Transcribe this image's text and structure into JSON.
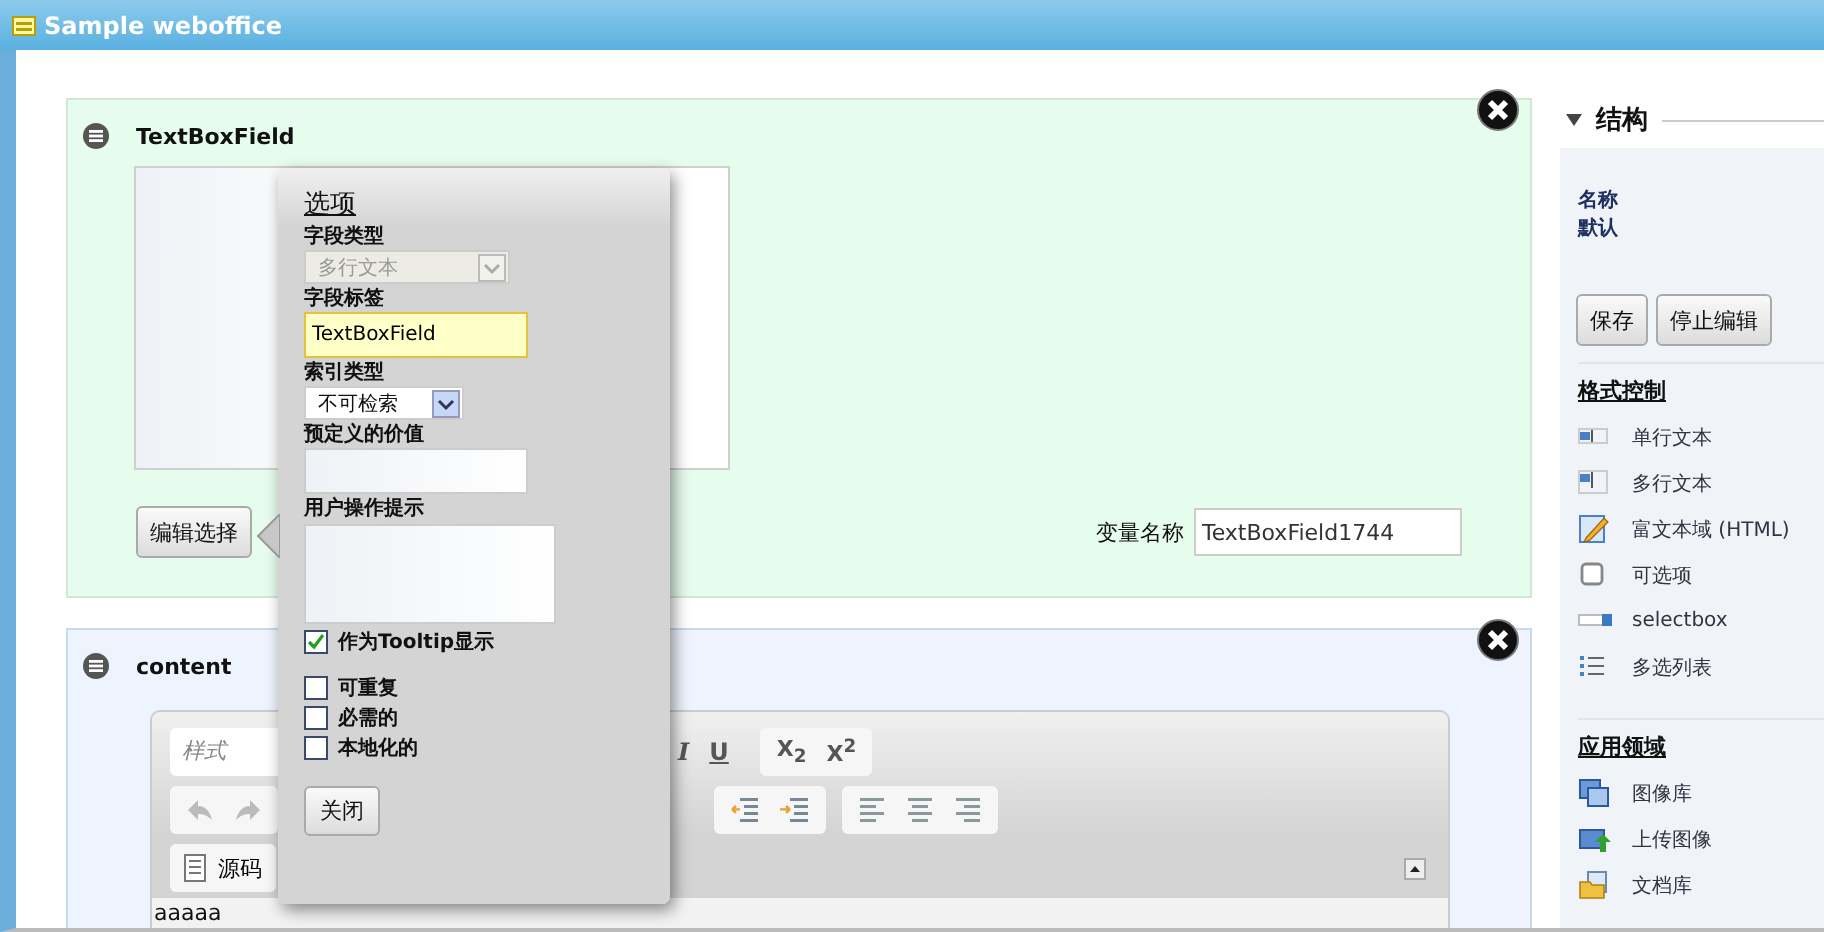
{
  "window": {
    "title": "Sample weboffice"
  },
  "fields": [
    {
      "kind": "textbox",
      "title": "TextBoxField",
      "edit_button": "编辑选择",
      "variable_label": "变量名称",
      "variable_value": "TextBoxField1744"
    },
    {
      "kind": "editor",
      "title": "content",
      "style_placeholder": "样式",
      "format_buttons": [
        {
          "kind": "italic",
          "text": "I"
        },
        {
          "kind": "underline",
          "text": "U"
        }
      ],
      "script_buttons": [
        "X$_{2}$",
        "X$^{2}$"
      ],
      "source_button": "源码",
      "content": "aaaaa"
    }
  ],
  "popup": {
    "title": "选项",
    "field_type": {
      "label": "字段类型",
      "value": "多行文本",
      "disabled": true
    },
    "field_label": {
      "label": "字段标签",
      "value": "TextBoxField"
    },
    "index_type": {
      "label": "索引类型",
      "value": "不可检索"
    },
    "predefined": {
      "label": "预定义的价值"
    },
    "hint": {
      "label": "用户操作提示"
    },
    "tooltip": {
      "label": "作为Tooltip显示",
      "checked": true
    },
    "options": [
      {
        "label": "可重复",
        "checked": false
      },
      {
        "label": "必需的",
        "checked": false
      },
      {
        "label": "本地化的",
        "checked": false
      }
    ],
    "close_button": "关闭"
  },
  "sidebar": {
    "heading": "结构",
    "expanded": true,
    "info": [
      "名称",
      "默认"
    ],
    "buttons": [
      "保存",
      "停止编辑"
    ],
    "sections": [
      {
        "title": "格式控制",
        "items": [
          {
            "label": "单行文本",
            "kind": "text"
          },
          {
            "label": "多行文本",
            "kind": "textarea"
          },
          {
            "label": "富文本域 (HTML)",
            "kind": "richtext"
          },
          {
            "label": "可选项",
            "kind": "checkbox"
          },
          {
            "label": "selectbox",
            "kind": "select"
          },
          {
            "label": "多选列表",
            "kind": "list"
          }
        ]
      },
      {
        "title": "应用领域",
        "items": [
          {
            "label": "图像库",
            "kind": "gallery"
          },
          {
            "label": "上传图像",
            "kind": "upload"
          },
          {
            "label": "文档库",
            "kind": "docs"
          }
        ]
      }
    ]
  }
}
